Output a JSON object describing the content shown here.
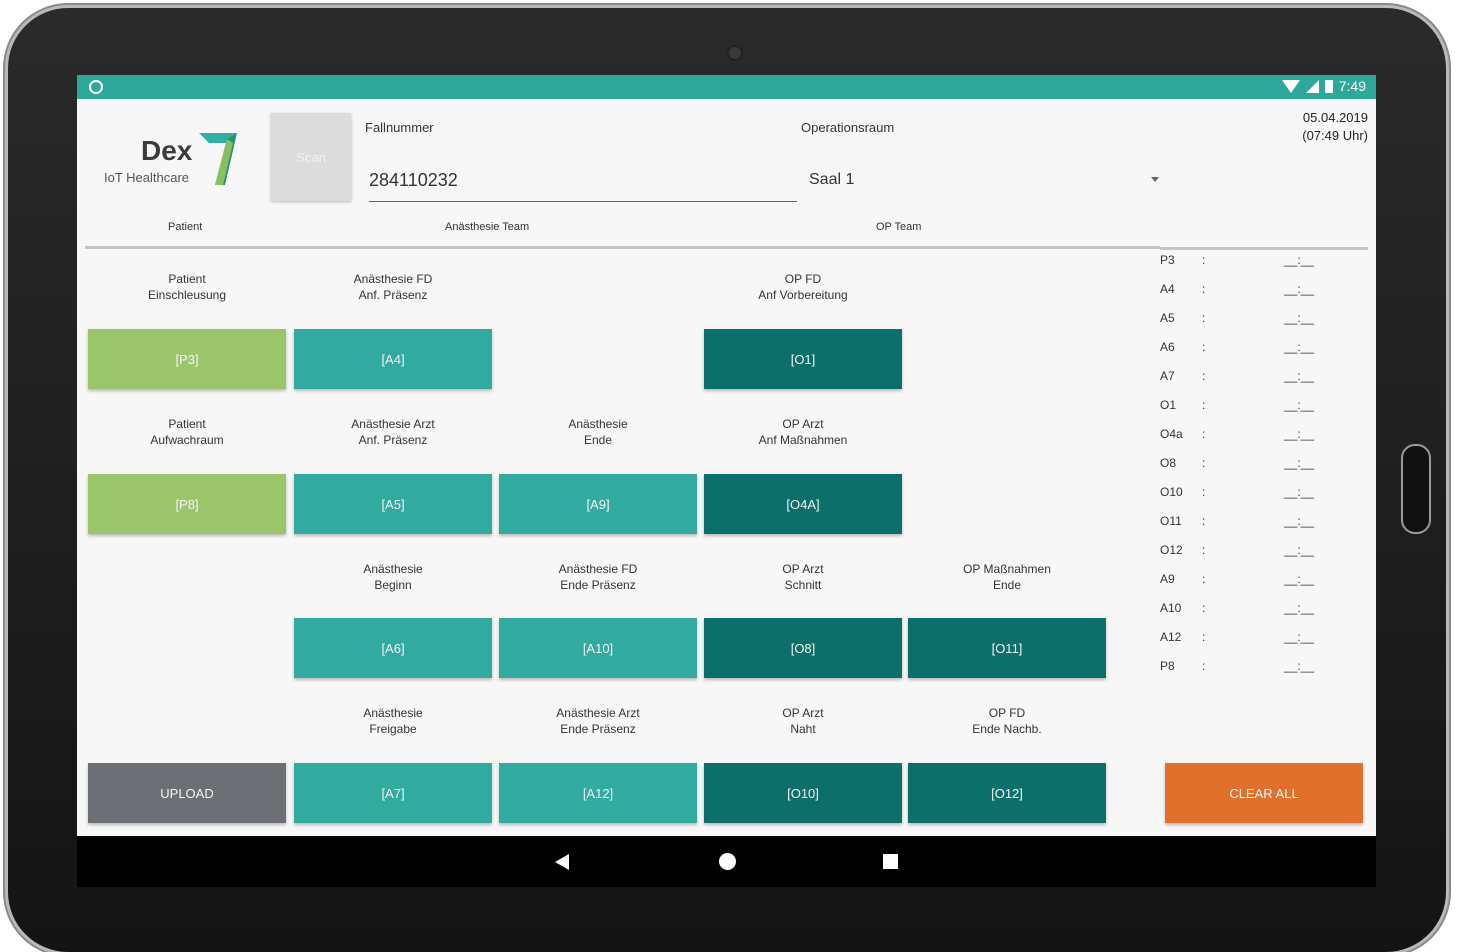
{
  "status_bar": {
    "time": "7:49"
  },
  "header": {
    "logo_name": "Dex",
    "logo_subtitle": "IoT Healthcare",
    "scan_label": "Scan",
    "fallnummer_label": "Fallnummer",
    "fallnummer_value": "284110232",
    "operationsraum_label": "Operationsraum",
    "operationsraum_value": "Saal 1",
    "date": "05.04.2019",
    "time": "(07:49 Uhr)"
  },
  "sections": {
    "patient": "Patient",
    "anaesthesie_team": "Anästhesie Team",
    "op_team": "OP Team"
  },
  "labels": {
    "r1c1": [
      "Patient",
      "Einschleusung"
    ],
    "r1c2": [
      "Anästhesie FD",
      "Anf. Präsenz"
    ],
    "r1c4": [
      "OP FD",
      "Anf Vorbereitung"
    ],
    "r2c1": [
      "Patient",
      "Aufwachraum"
    ],
    "r2c2": [
      "Anästhesie Arzt",
      "Anf. Präsenz"
    ],
    "r2c3": [
      "Anästhesie",
      "Ende"
    ],
    "r2c4": [
      "OP Arzt",
      "Anf Maßnahmen"
    ],
    "r3c2": [
      "Anästhesie",
      "Beginn"
    ],
    "r3c3": [
      "Anästhesie FD",
      "Ende Präsenz"
    ],
    "r3c4": [
      "OP Arzt",
      "Schnitt"
    ],
    "r3c5": [
      "OP Maßnahmen",
      "Ende"
    ],
    "r4c2": [
      "Anästhesie",
      "Freigabe"
    ],
    "r4c3": [
      "Anästhesie Arzt",
      "Ende Präsenz"
    ],
    "r4c4": [
      "OP Arzt",
      "Naht"
    ],
    "r4c5": [
      "OP FD",
      "Ende Nachb."
    ]
  },
  "tiles": {
    "p3": "[P3]",
    "a4": "[A4]",
    "o1": "[O1]",
    "p8": "[P8]",
    "a5": "[A5]",
    "a9": "[A9]",
    "o4a": "[O4A]",
    "a6": "[A6]",
    "a10": "[A10]",
    "o8": "[O8]",
    "o11": "[O11]",
    "upload": "UPLOAD",
    "a7": "[A7]",
    "a12": "[A12]",
    "o10": "[O10]",
    "o12": "[O12]",
    "clear_all": "CLEAR ALL"
  },
  "time_log": [
    {
      "id": "P3",
      "sep": ":",
      "value": "__:__"
    },
    {
      "id": "A4",
      "sep": ":",
      "value": "__:__"
    },
    {
      "id": "A5",
      "sep": ":",
      "value": "__:__"
    },
    {
      "id": "A6",
      "sep": ":",
      "value": "__:__"
    },
    {
      "id": "A7",
      "sep": ":",
      "value": "__:__"
    },
    {
      "id": "O1",
      "sep": ":",
      "value": "__:__"
    },
    {
      "id": "O4a",
      "sep": ":",
      "value": "__:__"
    },
    {
      "id": "O8",
      "sep": ":",
      "value": "__:__"
    },
    {
      "id": "O10",
      "sep": ":",
      "value": "__:__"
    },
    {
      "id": "O11",
      "sep": ":",
      "value": "__:__"
    },
    {
      "id": "O12",
      "sep": ":",
      "value": "__:__"
    },
    {
      "id": "A9",
      "sep": ":",
      "value": "__:__"
    },
    {
      "id": "A10",
      "sep": ":",
      "value": "__:__"
    },
    {
      "id": "A12",
      "sep": ":",
      "value": "__:__"
    },
    {
      "id": "P8",
      "sep": ":",
      "value": "__:__"
    }
  ],
  "colors": {
    "status_bar": "#2ea89b",
    "patient_tile": "#9bc56b",
    "anaesthesie_tile": "#31aaa0",
    "op_tile": "#0c6f6a",
    "upload_tile": "#6c6f73",
    "clear_tile": "#e0702c",
    "input_underline": "#c43a4a"
  }
}
